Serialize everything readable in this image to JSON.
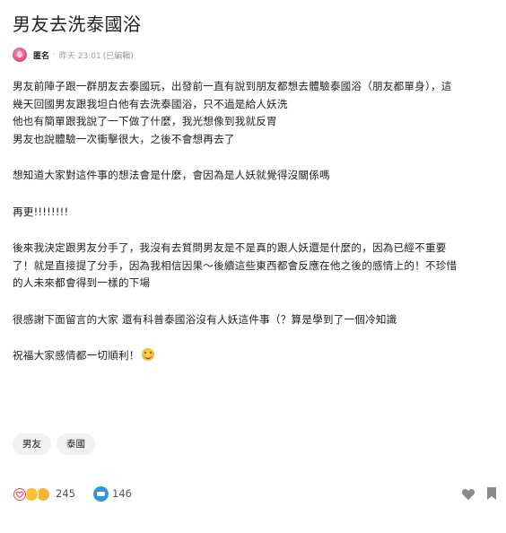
{
  "post": {
    "title": "男友去洗泰國浴",
    "author": "匿名",
    "dot": "·",
    "time": "昨天 23:01",
    "edited": "(已編輯)",
    "body_lines": [
      "男友前陣子跟一群朋友去泰國玩，出發前一直有說到朋友都想去體驗泰國浴（朋友都單身），這",
      "幾天回國男友跟我坦白他有去洗泰國浴，只不過是給人妖洗",
      "他也有簡單跟我說了一下做了什麼，我光想像到我就反胃",
      "男友也說體驗一次衝擊很大，之後不會想再去了",
      "想知道大家對這件事的想法會是什麼，會因為是人妖就覺得沒關係嗎",
      "再更!!!!!!!!",
      "後來我決定跟男友分手了，我沒有去質問男友是不是真的跟人妖還是什麼的，因為已經不重要",
      "了！就是直接提了分手，因為我相信因果～後續這些東西都會反應在他之後的感情上的！不珍惜",
      "的人未來都會得到一樣的下場",
      "很感謝下面留言的大家 還有科普泰國浴沒有人妖這件事（？算是學到了一個冷知識",
      "祝福大家感情都一切順利！"
    ]
  },
  "tags": [
    "男友",
    "泰國"
  ],
  "footer": {
    "reactions_count": "245",
    "comments_count": "146"
  },
  "icons": {
    "avatar": "anonymous-avatar",
    "emoji": "smiling-face-emoji",
    "heart": "heart-icon",
    "comment": "comment-icon",
    "like": "like-heart-icon",
    "bookmark": "bookmark-icon"
  }
}
